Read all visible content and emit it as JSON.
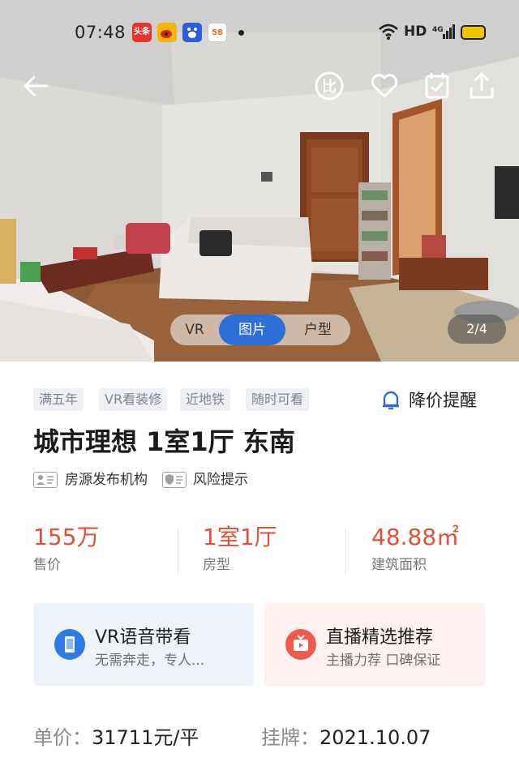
{
  "status_bar": {
    "time": "07:48",
    "apps": [
      {
        "icon": "toutiao-app-icon",
        "label": "头条",
        "color": "#e8322e"
      },
      {
        "icon": "weibo-app-icon",
        "label": "",
        "color": "#f7b400"
      },
      {
        "icon": "baidu-app-icon",
        "label": "",
        "color": "#2d5be3"
      },
      {
        "icon": "58-app-icon",
        "label": "58",
        "color": "#f4a320"
      }
    ],
    "network": "HD"
  },
  "gallery": {
    "tabs": [
      "VR",
      "图片",
      "户型"
    ],
    "active_tab": "图片",
    "counter": "2/4"
  },
  "tags": [
    "满五年",
    "VR看装修",
    "近地铁",
    "随时可看"
  ],
  "price_alert": "降价提醒",
  "title": "城市理想 1室1厅 东南",
  "meta": {
    "agency": "房源发布机构",
    "risk": "风险提示"
  },
  "stats": [
    {
      "value": "155万",
      "label": "售价"
    },
    {
      "value": "1室1厅",
      "label": "房型"
    },
    {
      "value": "48.88㎡",
      "label": "建筑面积"
    }
  ],
  "cards": [
    {
      "title": "VR语音带看",
      "subtitle": "无需奔走，专人...",
      "color": "#eef3f9",
      "icon_color": "#2f7be5"
    },
    {
      "title": "直播精选推荐",
      "subtitle": "主播力荐 口碑保证",
      "color": "#fdf1ef",
      "icon_color": "#ee5a4f"
    }
  ],
  "info": {
    "unit_price_label": "单价：",
    "unit_price": "31711元/平",
    "listed_label": "挂牌：",
    "listed": "2021.10.07"
  },
  "colors": {
    "accent": "#2d6fd8",
    "price": "#e0513b"
  }
}
